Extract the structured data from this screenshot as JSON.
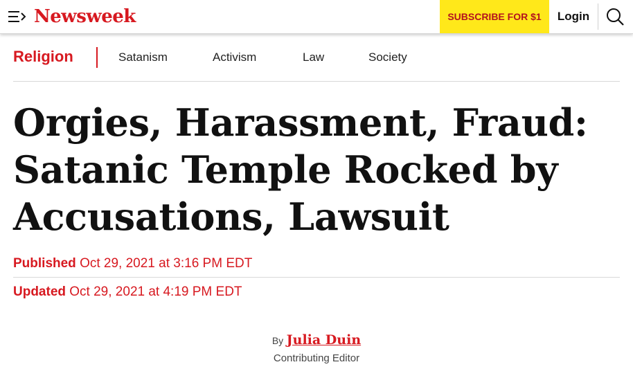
{
  "header": {
    "logo": "Newsweek",
    "subscribe_label": "SUBSCRIBE FOR $1",
    "login_label": "Login",
    "icons": [
      "menu-icon",
      "search-icon"
    ]
  },
  "subnav": {
    "section": "Religion",
    "links": [
      "Satanism",
      "Activism",
      "Law",
      "Society"
    ]
  },
  "article": {
    "headline": "Orgies, Harassment, Fraud: Satanic Temple Rocked by Accusations, Lawsuit",
    "published_label": "Published",
    "published_date": "Oct 29, 2021 at 3:16 PM EDT",
    "updated_label": "Updated",
    "updated_date": "Oct 29, 2021 at 4:19 PM EDT",
    "by_label": "By",
    "author": "Julia Duin",
    "author_role": "Contributing Editor"
  },
  "colors": {
    "brand_red": "#d71920",
    "subscribe_bg": "#ffe81a"
  }
}
